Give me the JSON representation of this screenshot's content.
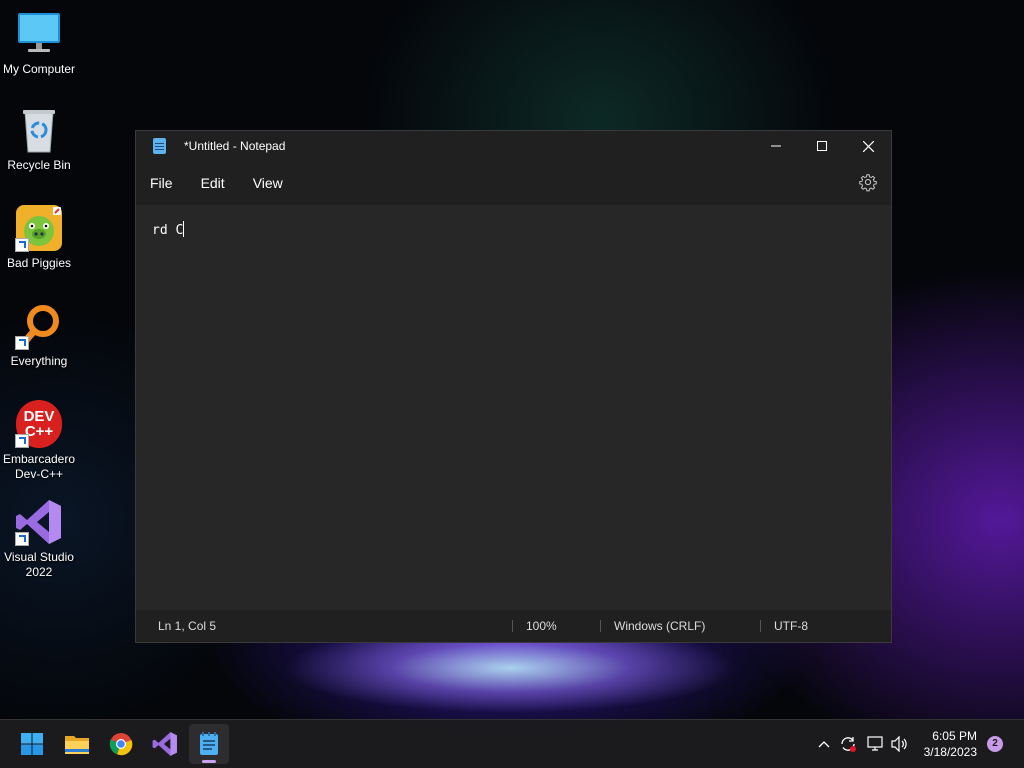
{
  "desktop": {
    "icons": [
      {
        "label": "My Computer"
      },
      {
        "label": "Recycle Bin"
      },
      {
        "label": "Bad Piggies"
      },
      {
        "label": "Everything"
      },
      {
        "label": "Embarcadero Dev-C++",
        "logo_text": "DEV C++"
      },
      {
        "label": "Visual Studio 2022"
      }
    ]
  },
  "notepad": {
    "title": "*Untitled - Notepad",
    "menu": [
      "File",
      "Edit",
      "View"
    ],
    "content": "rd C",
    "status": {
      "position": "Ln 1, Col 5",
      "zoom": "100%",
      "line_ending": "Windows (CRLF)",
      "encoding": "UTF-8"
    }
  },
  "taskbar": {
    "apps": [
      "start-icon",
      "file-explorer-icon",
      "chrome-icon",
      "visual-studio-icon",
      "notepad-icon"
    ],
    "active_app": "notepad-icon",
    "tray_icons": [
      "chevron-up-icon",
      "sync-icon",
      "network-icon",
      "volume-icon"
    ],
    "time": "6:05 PM",
    "date": "3/18/2023",
    "notification_count": "2"
  },
  "colors": {
    "window_bg": "#272727",
    "titlebar_bg": "#202020",
    "accent": "#c8a2f0"
  }
}
